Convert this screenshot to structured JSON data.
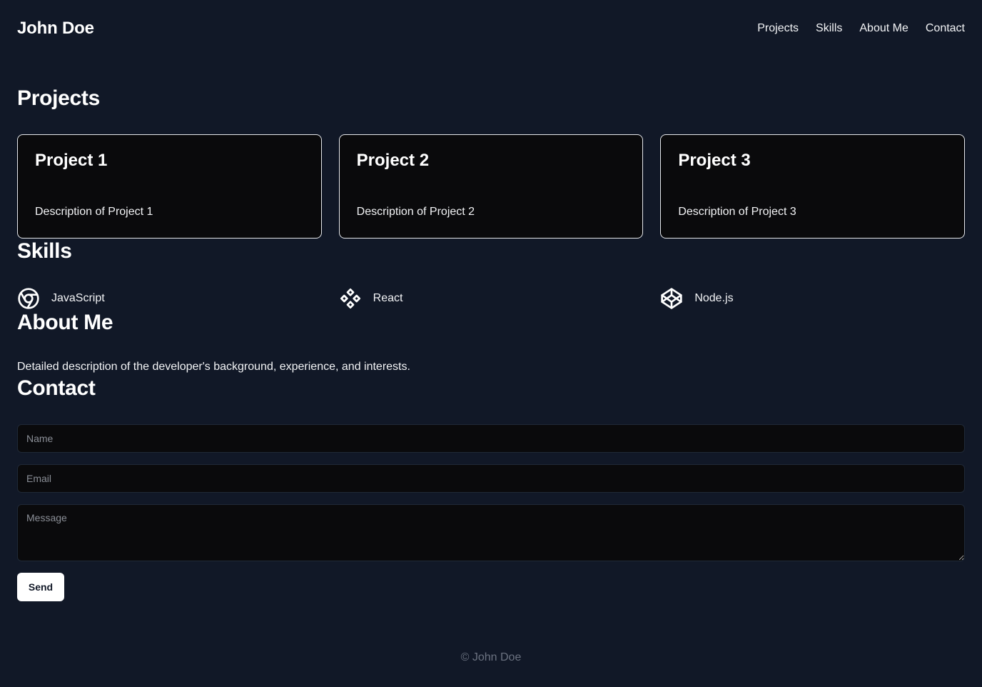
{
  "header": {
    "brand": "John Doe",
    "nav": [
      "Projects",
      "Skills",
      "About Me",
      "Contact"
    ]
  },
  "projects": {
    "heading": "Projects",
    "items": [
      {
        "title": "Project 1",
        "description": "Description of Project 1"
      },
      {
        "title": "Project 2",
        "description": "Description of Project 2"
      },
      {
        "title": "Project 3",
        "description": "Description of Project 3"
      }
    ]
  },
  "skills": {
    "heading": "Skills",
    "items": [
      {
        "label": "JavaScript",
        "icon": "chrome-icon"
      },
      {
        "label": "React",
        "icon": "diamond-cluster-icon"
      },
      {
        "label": "Node.js",
        "icon": "codepen-icon"
      }
    ]
  },
  "about": {
    "heading": "About Me",
    "text": "Detailed description of the developer's background, experience, and interests."
  },
  "contact": {
    "heading": "Contact",
    "name_placeholder": "Name",
    "email_placeholder": "Email",
    "message_placeholder": "Message",
    "send_label": "Send"
  },
  "footer": {
    "text": "© John Doe"
  },
  "colors": {
    "background": "#111827",
    "card_background": "#0a0a0c",
    "text": "#ffffff",
    "muted": "#6b7280"
  }
}
